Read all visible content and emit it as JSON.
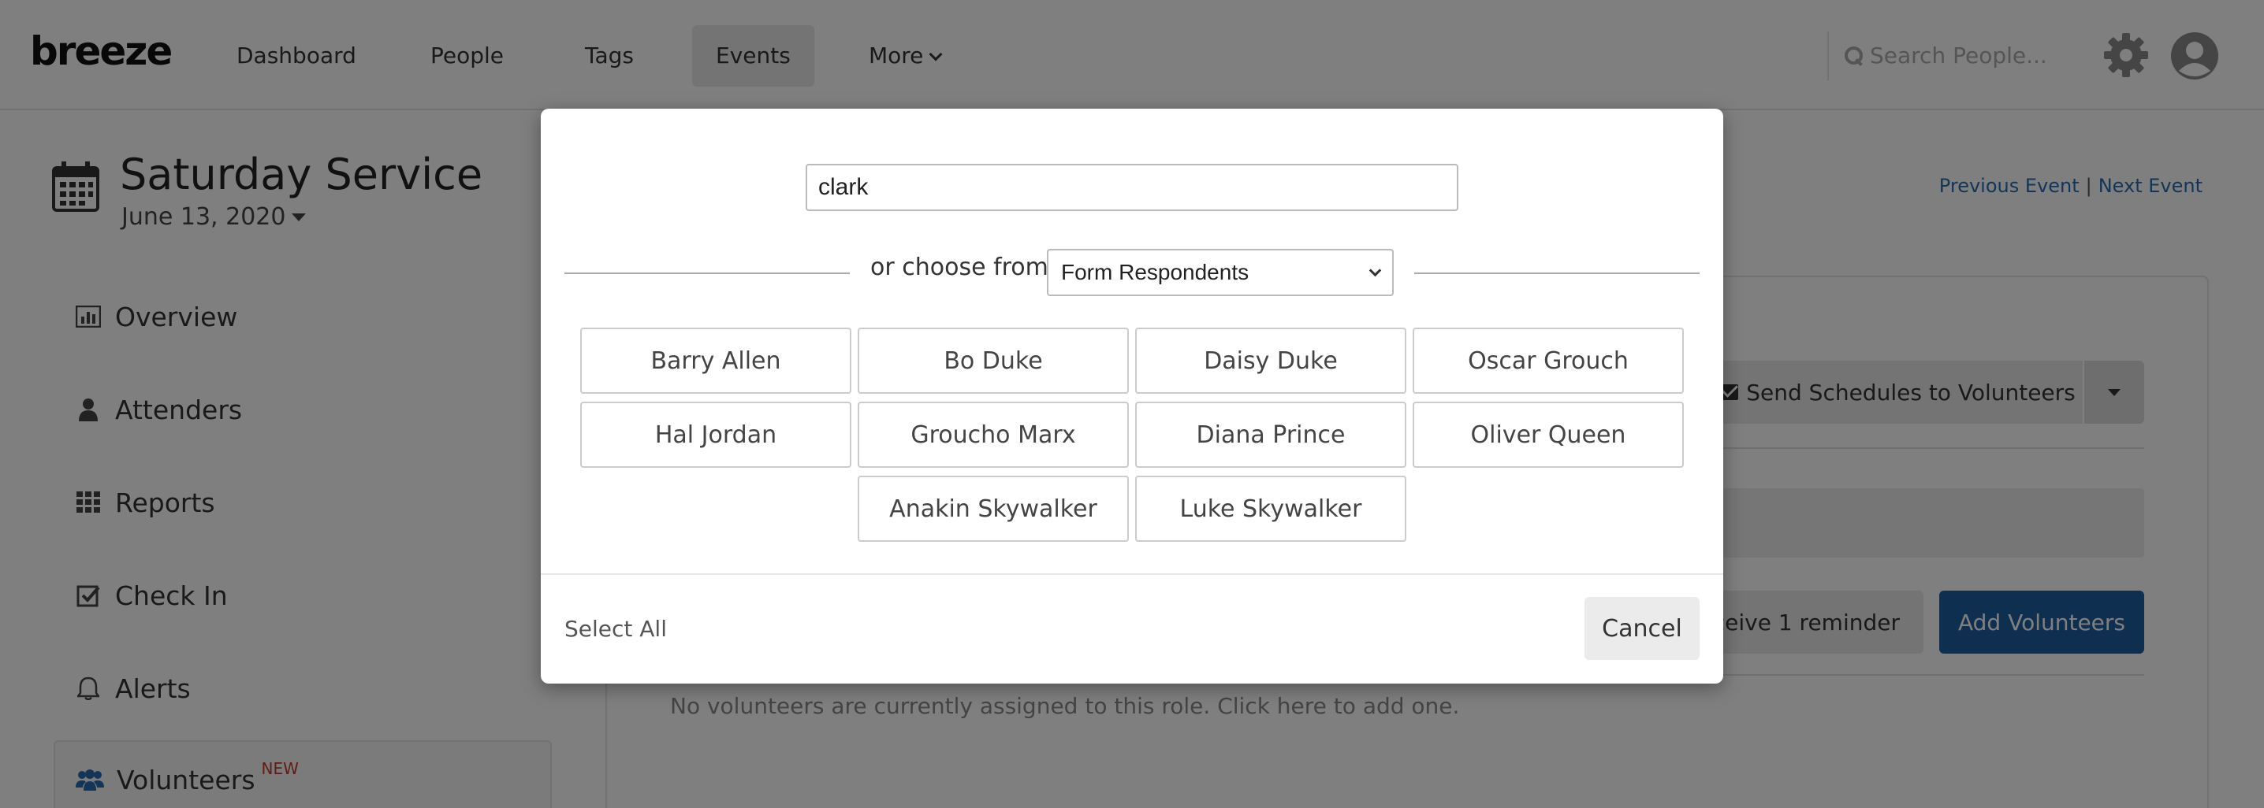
{
  "header": {
    "logo": "breeze",
    "nav": [
      {
        "label": "Dashboard"
      },
      {
        "label": "People"
      },
      {
        "label": "Tags"
      },
      {
        "label": "Events",
        "active": true
      },
      {
        "label": "More"
      }
    ],
    "search_placeholder": "Search People...",
    "icons": [
      "search-icon",
      "gear-icon",
      "user-avatar-icon"
    ]
  },
  "page": {
    "title": "Saturday Service",
    "date": "June 13, 2020",
    "previous_event": "Previous Event",
    "separator": "|",
    "next_event": "Next Event"
  },
  "sidebar": {
    "items": [
      {
        "label": "Overview",
        "icon": "bar-chart-icon"
      },
      {
        "label": "Attenders",
        "icon": "person-icon"
      },
      {
        "label": "Reports",
        "icon": "grid-icon"
      },
      {
        "label": "Check In",
        "icon": "check-square-icon"
      },
      {
        "label": "Alerts",
        "icon": "bell-icon"
      },
      {
        "label": "Volunteers",
        "icon": "users-icon",
        "badge": "NEW",
        "active": true
      }
    ]
  },
  "main": {
    "send_schedules": "Send Schedules to Volunteers",
    "reminder": "eceive 1 reminder",
    "add_volunteers": "Add Volunteers",
    "empty_message": "No volunteers are currently assigned to this role. Click here to add one."
  },
  "modal": {
    "search_value": "clark",
    "choose_label": "or choose from",
    "choose_selected": "Form Respondents",
    "people": [
      "Barry Allen",
      "Bo Duke",
      "Daisy Duke",
      "Oscar Grouch",
      "Hal Jordan",
      "Groucho Marx",
      "Diana Prince",
      "Oliver Queen",
      "Anakin Skywalker",
      "Luke Skywalker"
    ],
    "select_all": "Select All",
    "cancel": "Cancel"
  },
  "colors": {
    "brand_blue": "#1f5fa3",
    "link_blue": "#2a6bb0",
    "new_badge": "#c0392b",
    "overlay": "rgba(0,0,0,0.5)"
  }
}
